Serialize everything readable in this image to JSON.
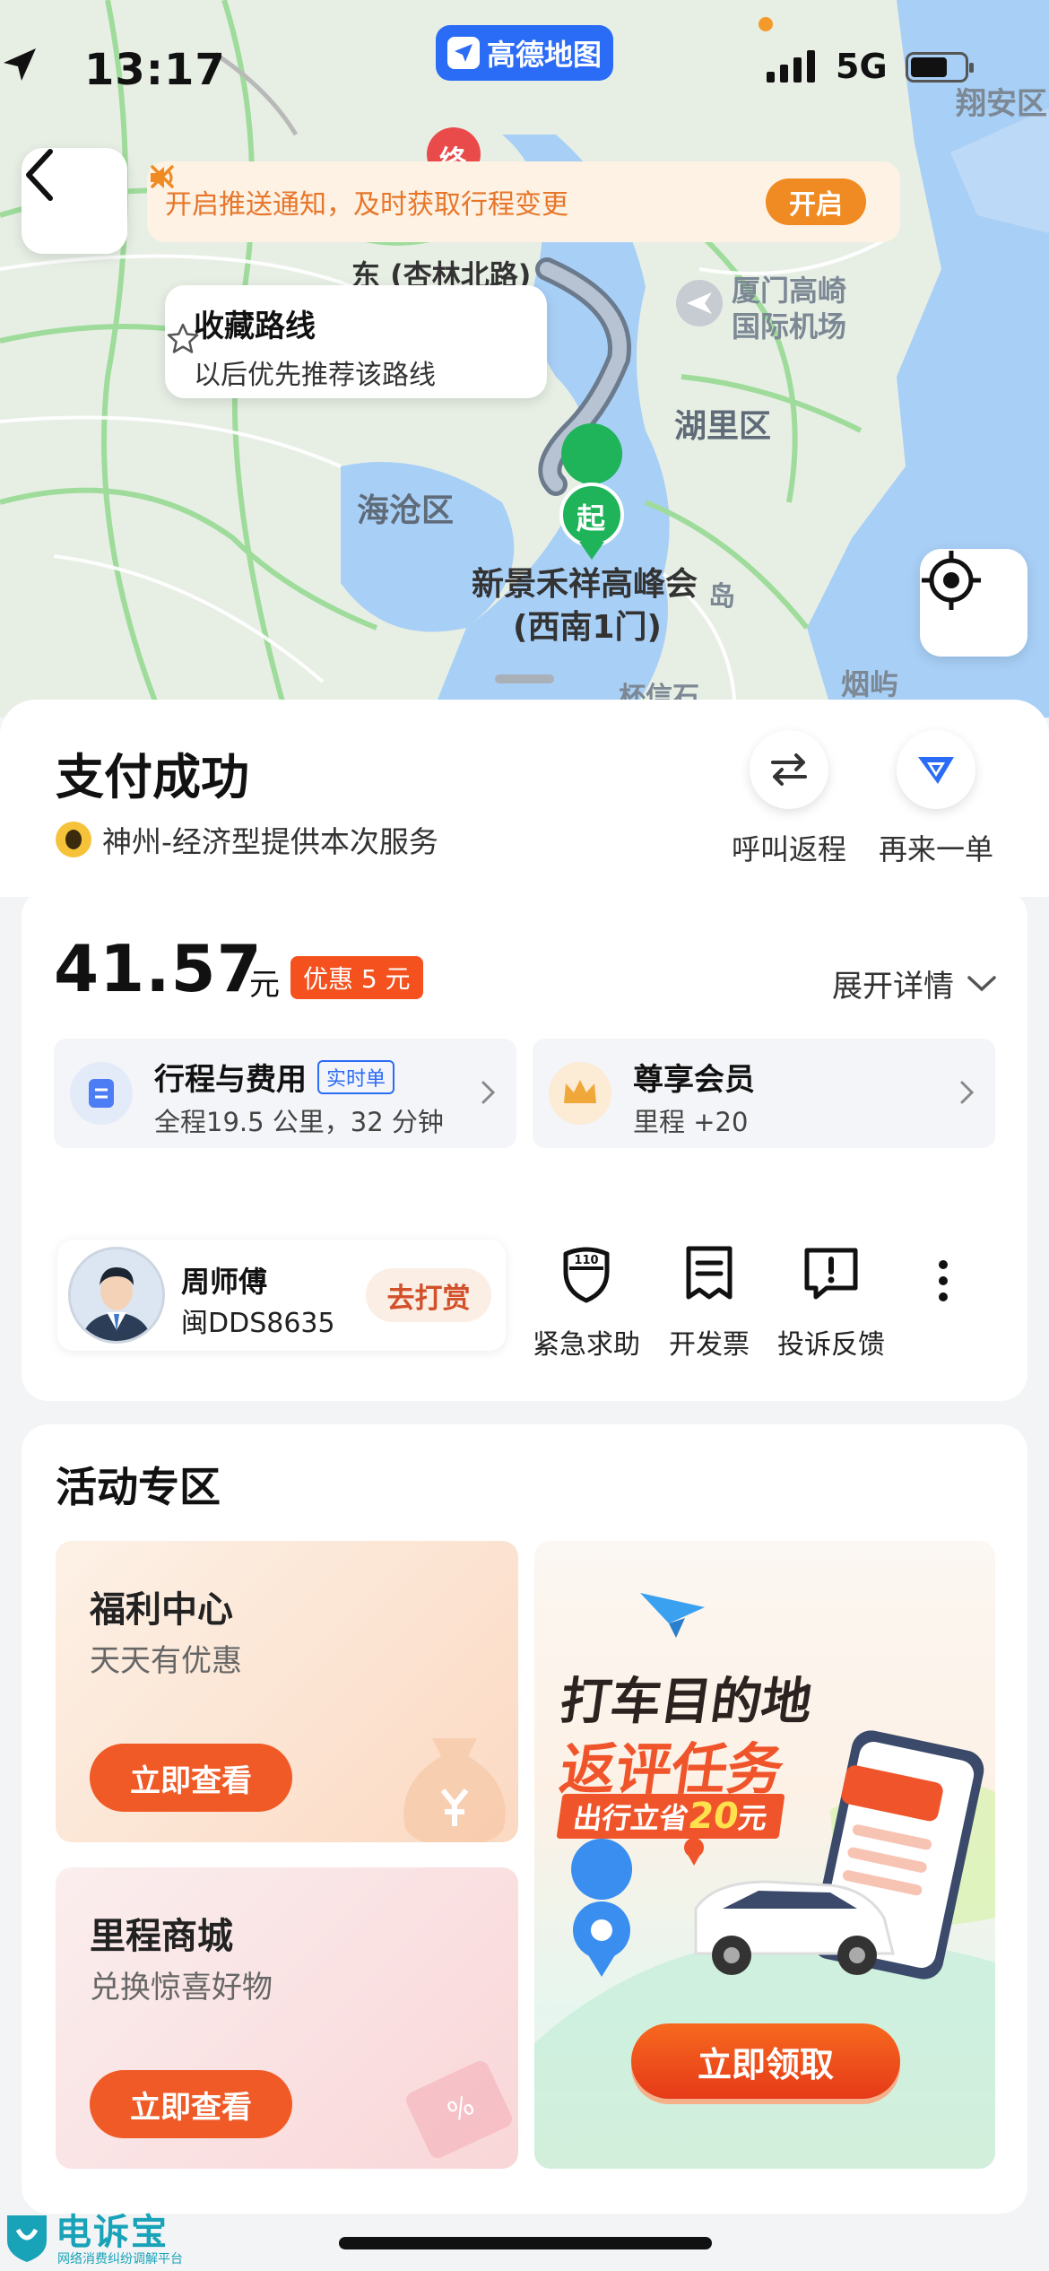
{
  "status_bar": {
    "time": "13:17",
    "network": "5G",
    "app_name": "高德地图"
  },
  "notice": {
    "text": "开启推送通知，及时获取行程变更",
    "button": "开启"
  },
  "route_tip": {
    "title": "收藏路线",
    "subtitle": "以后优先推荐该路线"
  },
  "map": {
    "labels": {
      "top_right": "翔安区",
      "road": "东 (杏林北路)",
      "airport": "厦门高崎\n国际机场",
      "huli": "湖里区",
      "haicang": "海沧区",
      "start_name": "新景禾祥高峰会",
      "start_gate": "(西南1门)",
      "start_marker": "起",
      "end_marker": "终",
      "bottom_right": "烟屿",
      "bottom_mid": "杯信石",
      "island": "岛"
    }
  },
  "header": {
    "title": "支付成功",
    "provider": "神州-经济型提供本次服务",
    "actions": [
      {
        "label": "呼叫返程"
      },
      {
        "label": "再来一单"
      }
    ]
  },
  "fare": {
    "amount": "41.57",
    "unit": "元",
    "discount": "优惠 5 元",
    "expand": "展开详情",
    "trip": {
      "title": "行程与费用",
      "tag": "实时单",
      "detail": "全程19.5 公里，32 分钟"
    },
    "member": {
      "title": "尊享会员",
      "detail": "里程 +20"
    }
  },
  "driver": {
    "name": "周师傅",
    "plate": "闽DDS8635",
    "tip_button": "去打赏"
  },
  "services": [
    {
      "label": "紧急求助",
      "icon": "shield-110-icon",
      "badge": "110"
    },
    {
      "label": "开发票",
      "icon": "invoice-icon"
    },
    {
      "label": "投诉反馈",
      "icon": "complaint-icon"
    }
  ],
  "activity": {
    "title": "活动专区",
    "tiles": [
      {
        "title": "福利中心",
        "subtitle": "天天有优惠",
        "button": "立即查看"
      },
      {
        "title": "里程商城",
        "subtitle": "兑换惊喜好物",
        "button": "立即查看"
      }
    ],
    "promo": {
      "line1": "打车目的地",
      "line2": "返评任务",
      "line3_pre": "出行立省",
      "line3_amount": "20",
      "line3_unit": "元",
      "cta": "立即领取"
    }
  },
  "watermark": {
    "name": "电诉宝",
    "sub": "网络消费纠纷调解平台"
  },
  "colors": {
    "accent": "#f05a26",
    "blue": "#2b6cf6",
    "notice_bg": "#fdf2e4",
    "route_green": "#1fb45a"
  }
}
